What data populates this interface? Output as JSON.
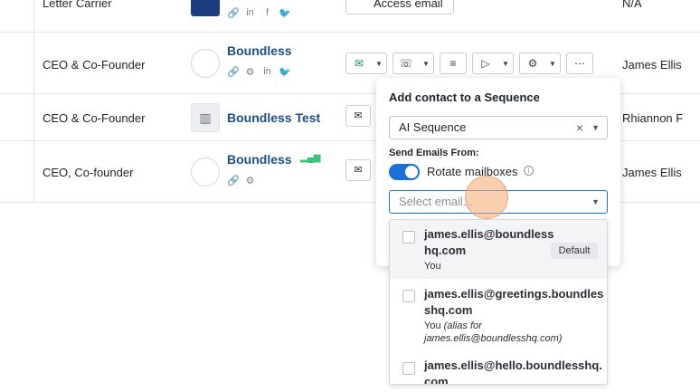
{
  "rows": [
    {
      "title": "Letter Carrier",
      "owner": "N/A",
      "access_label": "Access email"
    },
    {
      "title": "CEO & Co-Founder",
      "company": "Boundless",
      "owner": "James Ellis"
    },
    {
      "title": "CEO & Co-Founder",
      "company": "Boundless Test",
      "owner": "Rhiannon F"
    },
    {
      "title": "CEO, Co-founder",
      "company": "Boundless",
      "owner": "James Ellis"
    }
  ],
  "icons": {
    "link": "🔗",
    "linkedin": "in",
    "facebook": "f",
    "twitter": "🐦",
    "hubspot": "⚙",
    "mail": "✉",
    "phone": "☏",
    "task": "≡",
    "send": "▷",
    "more": "⋯",
    "caret": "▼",
    "building": "▥",
    "signal": "▂▄▆"
  },
  "sequence_panel": {
    "title": "Add contact to a Sequence",
    "sequence_value": "AI Sequence",
    "clear_icon": "×",
    "send_from_label": "Send Emails From:",
    "rotate_label": "Rotate mailboxes",
    "rotate_on": true,
    "info_icon": "i",
    "email_placeholder": "Select email..."
  },
  "email_options": [
    {
      "email": "james.ellis@boundless hq.com",
      "sub": "You",
      "badge": "Default"
    },
    {
      "email": "james.ellis@greetings.boundles shq.com",
      "sub": "You",
      "alias": "(alias for james.ellis@boundlesshq.com)"
    },
    {
      "email": "james.ellis@hello.boundlesshq. com",
      "sub": ""
    }
  ],
  "colors": {
    "accent": "#1a6fd8",
    "company_link": "#1c4f86",
    "signal_green": "#3cc47c"
  }
}
